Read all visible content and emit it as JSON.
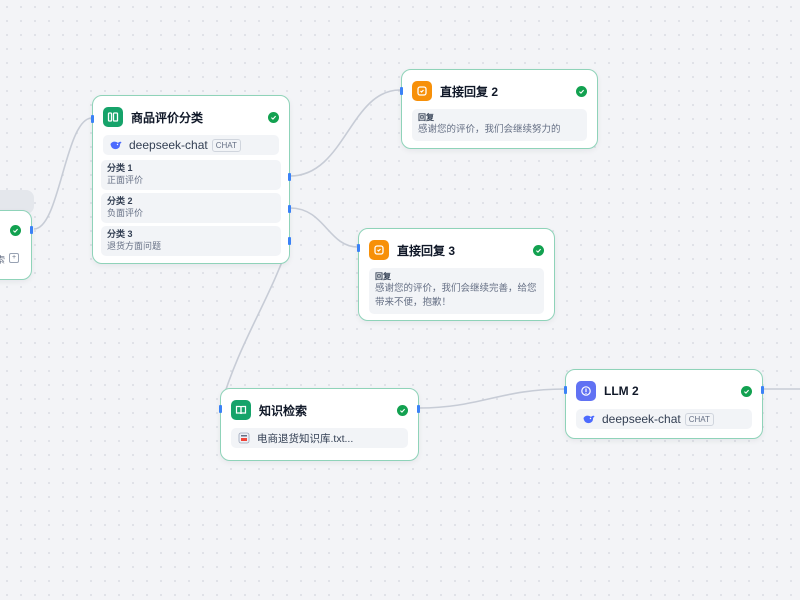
{
  "colors": {
    "node_border": "#8fd3b9",
    "green_icon": "#16a36a",
    "orange_icon": "#f79009",
    "purple_icon": "#6172f3",
    "check": "#12a150",
    "handle": "#3b82f6"
  },
  "left_partial_node": {
    "icon": "check-icon",
    "fragment_text": "索",
    "fragment_icon": "expand-icon"
  },
  "classifier_node": {
    "title": "商品评价分类",
    "icon": "classifier-icon",
    "model": "deepseek-chat",
    "model_badge": "CHAT",
    "classes": [
      {
        "label": "分类 1",
        "text": "正面评价"
      },
      {
        "label": "分类 2",
        "text": "负面评价"
      },
      {
        "label": "分类 3",
        "text": "退货方面问题"
      }
    ]
  },
  "reply2_node": {
    "title": "直接回复 2",
    "icon": "reply-icon",
    "field_label": "回复",
    "text": "感谢您的评价，我们会继续努力的"
  },
  "reply3_node": {
    "title": "直接回复 3",
    "icon": "reply-icon",
    "field_label": "回复",
    "text_line1": "感谢您的评价，我们会继续完善，给您",
    "text_line2": "带来不便，抱歉！"
  },
  "knowledge_node": {
    "title": "知识检索",
    "icon": "book-icon",
    "dataset": "电商退货知识库.txt..."
  },
  "llm2_node": {
    "title": "LLM 2",
    "icon": "llm-icon",
    "model": "deepseek-chat",
    "model_badge": "CHAT"
  }
}
